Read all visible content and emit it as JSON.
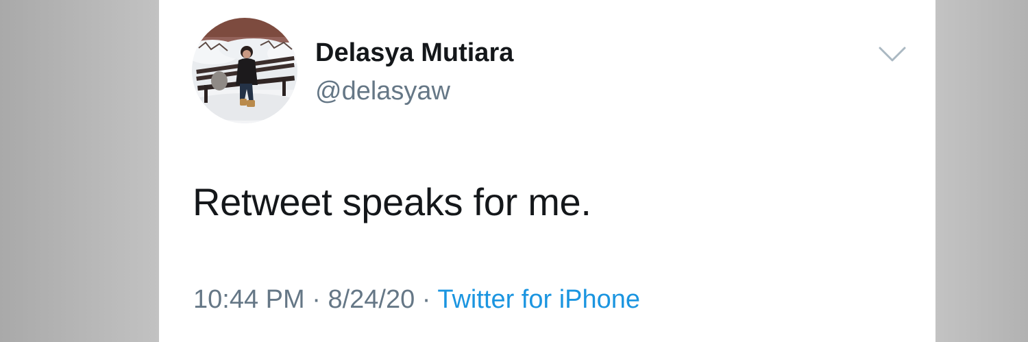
{
  "tweet": {
    "author": {
      "display_name": "Delasya Mutiara",
      "handle": "@delasyaw",
      "avatar_icon": "profile-photo-snowy-bench"
    },
    "menu_icon": "chevron-down-icon",
    "text": "Retweet speaks for me.",
    "time": "10:44 PM",
    "separator": "·",
    "date": "8/24/20",
    "source": "Twitter for iPhone"
  },
  "colors": {
    "text_primary": "#14171a",
    "text_secondary": "#657786",
    "link": "#1b95e0",
    "background": "#ffffff"
  }
}
